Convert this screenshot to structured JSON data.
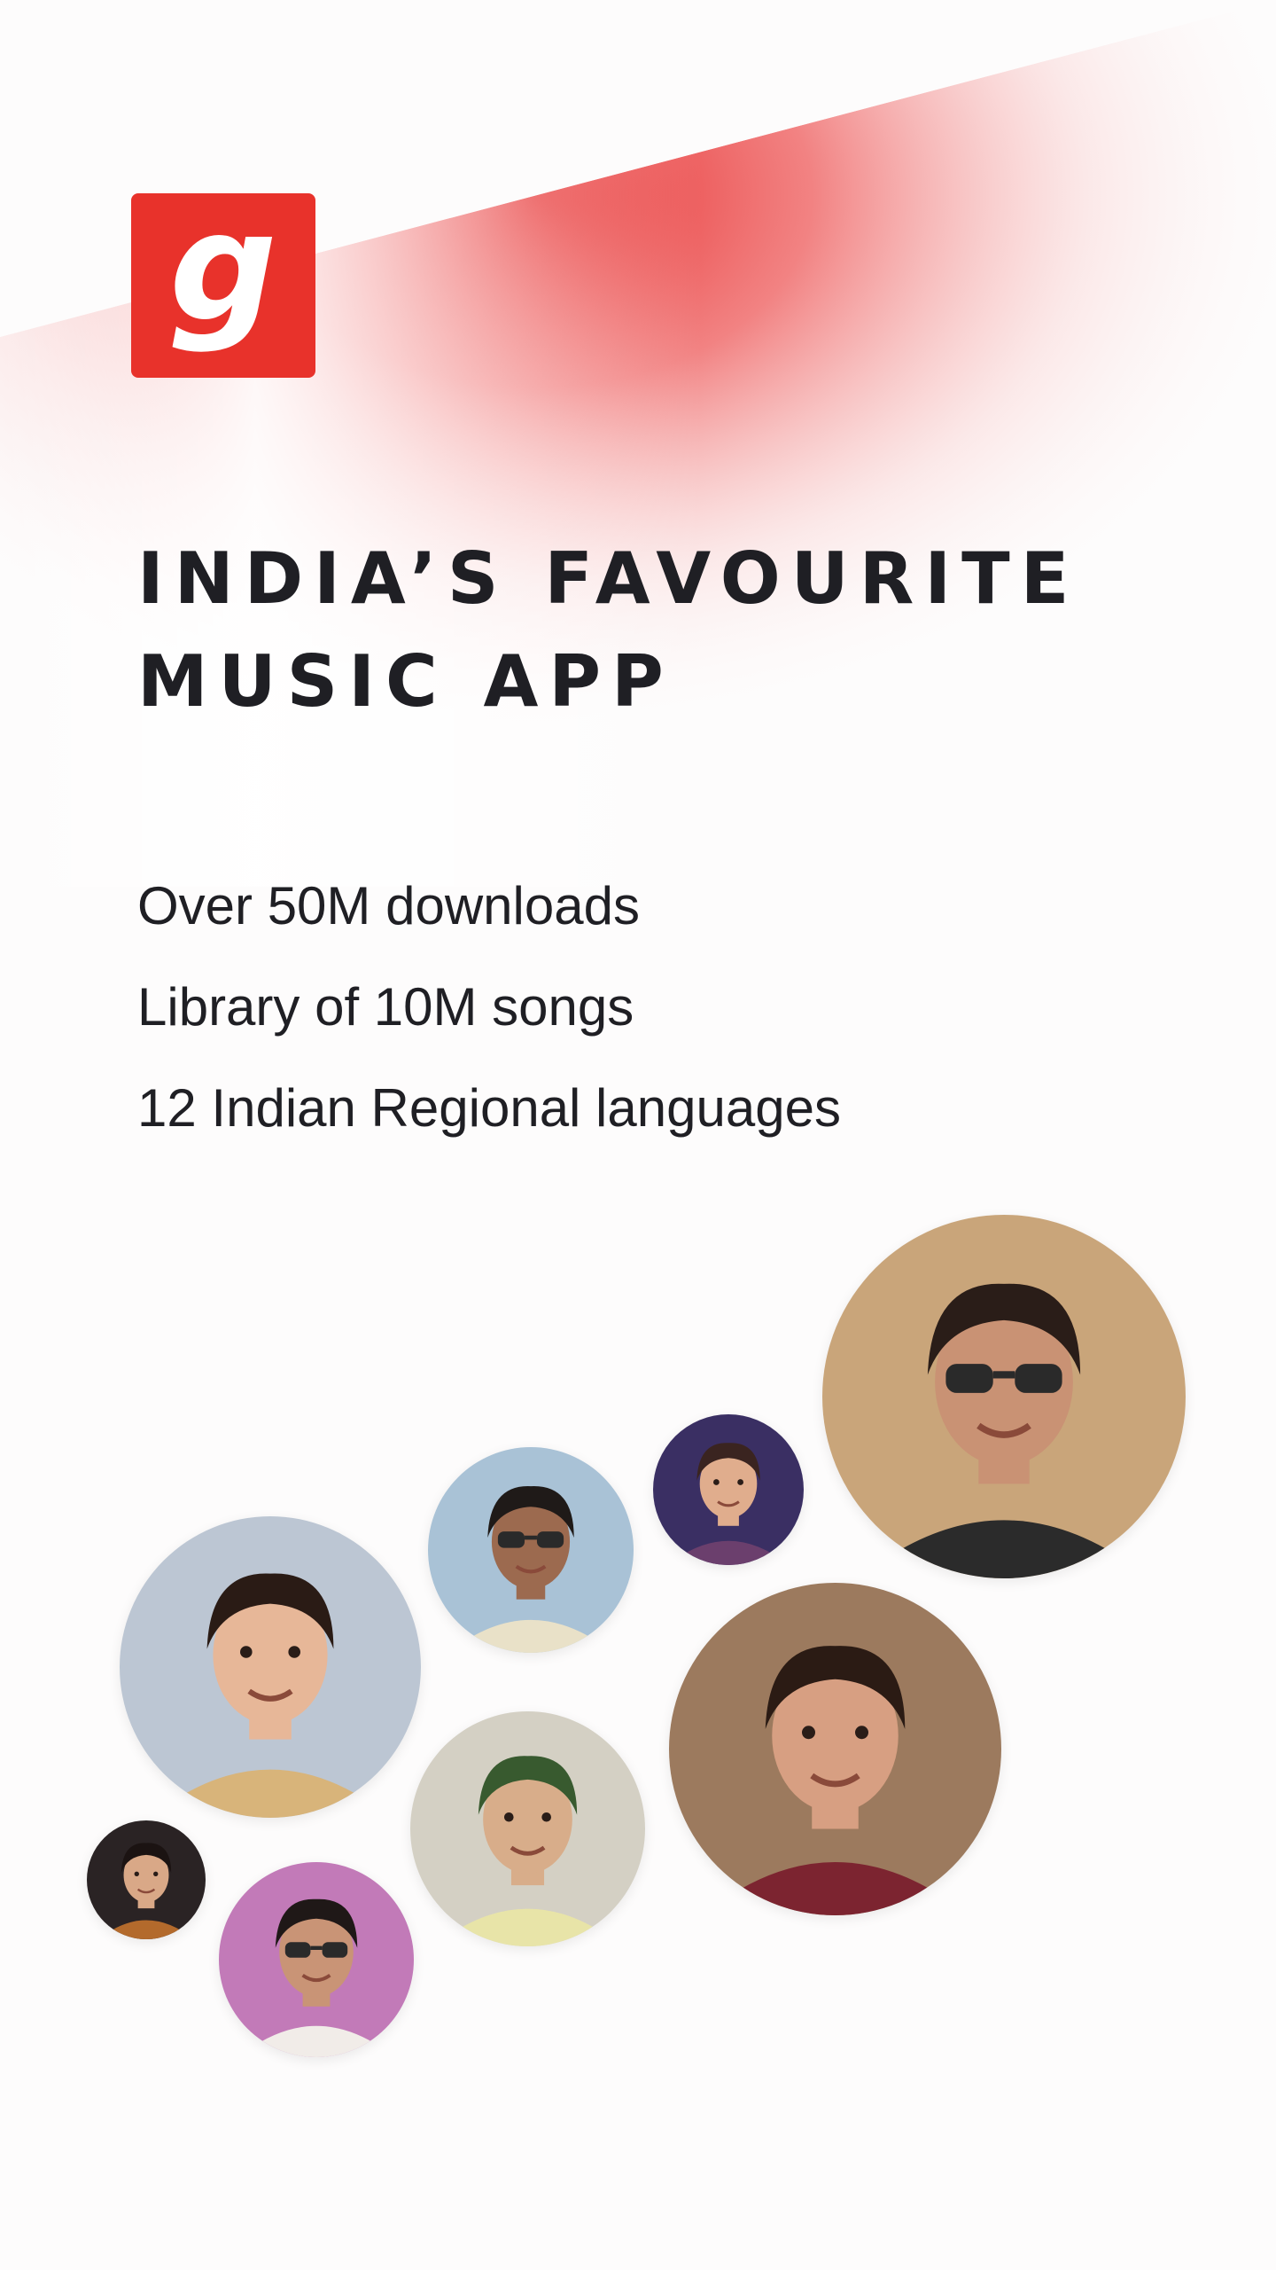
{
  "brand": {
    "logo_letter": "g",
    "color": "#e8322b"
  },
  "headline": {
    "line1": "INDIA’S FAVOURITE",
    "line2": "MUSIC APP"
  },
  "features": [
    "Over 50M downloads",
    "Library of 10M songs",
    "12 Indian Regional languages"
  ],
  "artists": [
    {
      "name": "artist-portrait-1",
      "bg": "#c9a57a",
      "skin": "#c99274",
      "hair": "#2a1d18",
      "shirt": "#2b2b2b",
      "glasses": true
    },
    {
      "name": "artist-portrait-2",
      "bg": "#3a2f63",
      "skin": "#e0ad8d",
      "hair": "#3a2420",
      "shirt": "#6b3f6d",
      "glasses": false
    },
    {
      "name": "artist-portrait-3",
      "bg": "#a9c2d6",
      "skin": "#9c6a4f",
      "hair": "#1f1a18",
      "shirt": "#e9e1c8",
      "glasses": true
    },
    {
      "name": "artist-portrait-4",
      "bg": "#bcc6d3",
      "skin": "#e7b798",
      "hair": "#2a1b15",
      "shirt": "#d8b47a",
      "glasses": false
    },
    {
      "name": "artist-portrait-5",
      "bg": "#9c7a5e",
      "skin": "#d79f82",
      "hair": "#2b1b14",
      "shirt": "#7c2430",
      "glasses": false
    },
    {
      "name": "artist-portrait-6",
      "bg": "#d4d0c4",
      "skin": "#d8ad8a",
      "hair": "#385a2f",
      "shirt": "#e8e4a8",
      "glasses": false
    },
    {
      "name": "artist-portrait-7",
      "bg": "#2a2324",
      "skin": "#d9a887",
      "hair": "#1b1312",
      "shirt": "#b36a2c",
      "glasses": false
    },
    {
      "name": "artist-portrait-8",
      "bg": "#c27ab8",
      "skin": "#c99476",
      "hair": "#1f1817",
      "shirt": "#f1ece8",
      "glasses": true
    }
  ]
}
